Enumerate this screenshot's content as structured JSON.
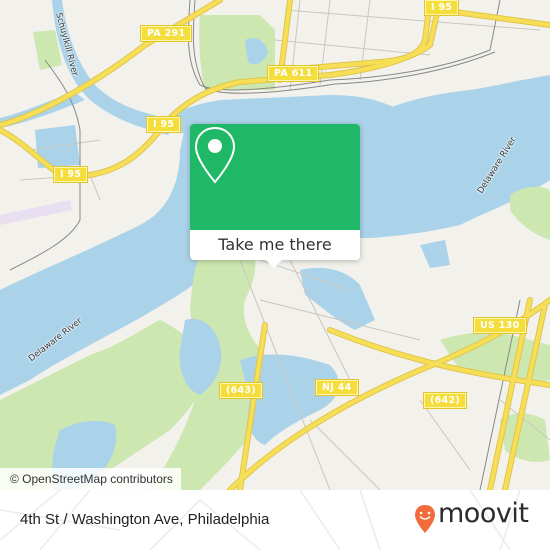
{
  "map": {
    "colors": {
      "land": "#f2f1ec",
      "water": "#aad3ea",
      "park": "#cde7b0",
      "highway": "#f6df57",
      "highway_casing": "#e0c54a",
      "minor_road": "#c9c6c0",
      "rail": "#888888"
    },
    "road_shields": [
      {
        "id": "pa-291",
        "label": "PA 291"
      },
      {
        "id": "pa-611",
        "label": "PA 611"
      },
      {
        "id": "i-95-top",
        "label": "I 95"
      },
      {
        "id": "i-95-mid",
        "label": "I 95"
      },
      {
        "id": "i-95-left",
        "label": "I 95"
      },
      {
        "id": "us-130",
        "label": "US 130"
      },
      {
        "id": "nj-44",
        "label": "NJ 44"
      },
      {
        "id": "cr-643",
        "label": "(643)"
      },
      {
        "id": "cr-642",
        "label": "(642)"
      }
    ],
    "water_labels": [
      {
        "id": "schuylkill",
        "label": "Schuylkill River"
      },
      {
        "id": "delaware-east",
        "label": "Delaware River"
      },
      {
        "id": "delaware-west",
        "label": "Delaware River"
      }
    ],
    "attribution": "© OpenStreetMap contributors"
  },
  "popup": {
    "icon": "map-pin-icon",
    "button_label": "Take me there",
    "accent_color": "#1fb866"
  },
  "footer": {
    "address": "4th St / Washington Ave, Philadelphia",
    "brand": "moovit",
    "brand_color": "#f26b3a"
  }
}
